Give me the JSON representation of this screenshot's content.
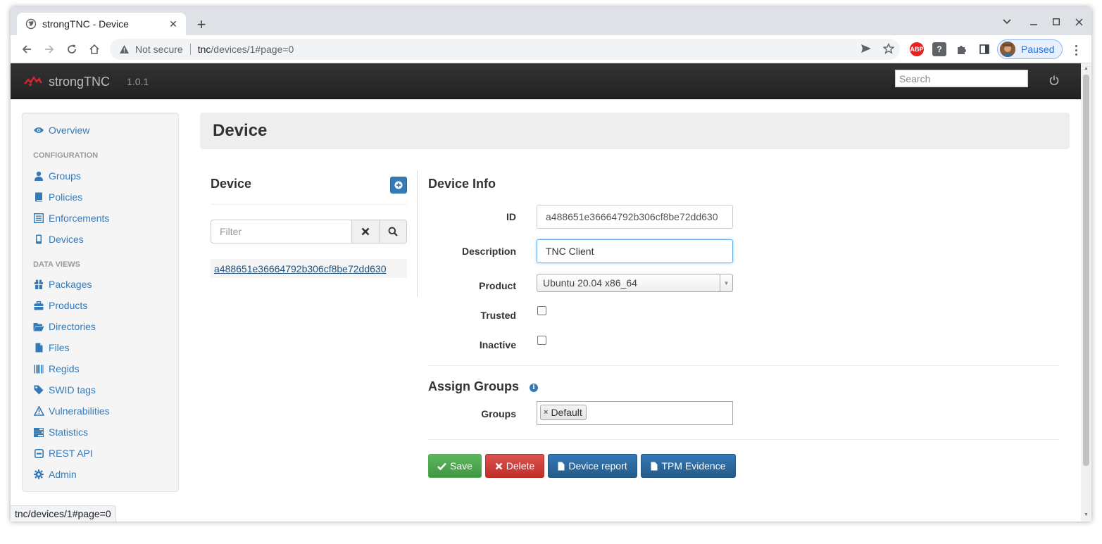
{
  "browser": {
    "tab_title": "strongTNC - Device",
    "new_tab": "+",
    "security_label": "Not secure",
    "url_host": "tnc",
    "url_path": "/devices/1#page=0",
    "profile_label": "Paused",
    "ext_abp": "ABP",
    "ext_help": "?"
  },
  "navbar": {
    "brand": "strongTNC",
    "version": "1.0.1",
    "search_placeholder": "Search"
  },
  "sidebar": {
    "overview": "Overview",
    "config_header": "CONFIGURATION",
    "config_items": [
      "Groups",
      "Policies",
      "Enforcements",
      "Devices"
    ],
    "data_header": "DATA VIEWS",
    "data_items": [
      "Packages",
      "Products",
      "Directories",
      "Files",
      "Regids",
      "SWID tags",
      "Vulnerabilities",
      "Statistics",
      "REST API",
      "Admin"
    ]
  },
  "page": {
    "heading": "Device"
  },
  "device_list": {
    "title": "Device",
    "filter_placeholder": "Filter",
    "items": [
      "a488651e36664792b306cf8be72dd630"
    ]
  },
  "device_info": {
    "title": "Device Info",
    "id_label": "ID",
    "id_value": "a488651e36664792b306cf8be72dd630",
    "description_label": "Description",
    "description_value": "TNC Client",
    "product_label": "Product",
    "product_value": "Ubuntu 20.04 x86_64",
    "trusted_label": "Trusted",
    "trusted_checked": false,
    "inactive_label": "Inactive",
    "inactive_checked": false
  },
  "assign_groups": {
    "title": "Assign Groups",
    "groups_label": "Groups",
    "groups": [
      "Default"
    ]
  },
  "actions": {
    "save": "Save",
    "delete": "Delete",
    "device_report": "Device report",
    "tpm_evidence": "TPM Evidence"
  },
  "status_url": "tnc/devices/1#page=0",
  "colors": {
    "link": "#337ab7",
    "success": "#5cb85c",
    "danger": "#d9534f",
    "primary": "#337ab7",
    "navbar": "#222222",
    "brand_logo": "#d9232e"
  }
}
